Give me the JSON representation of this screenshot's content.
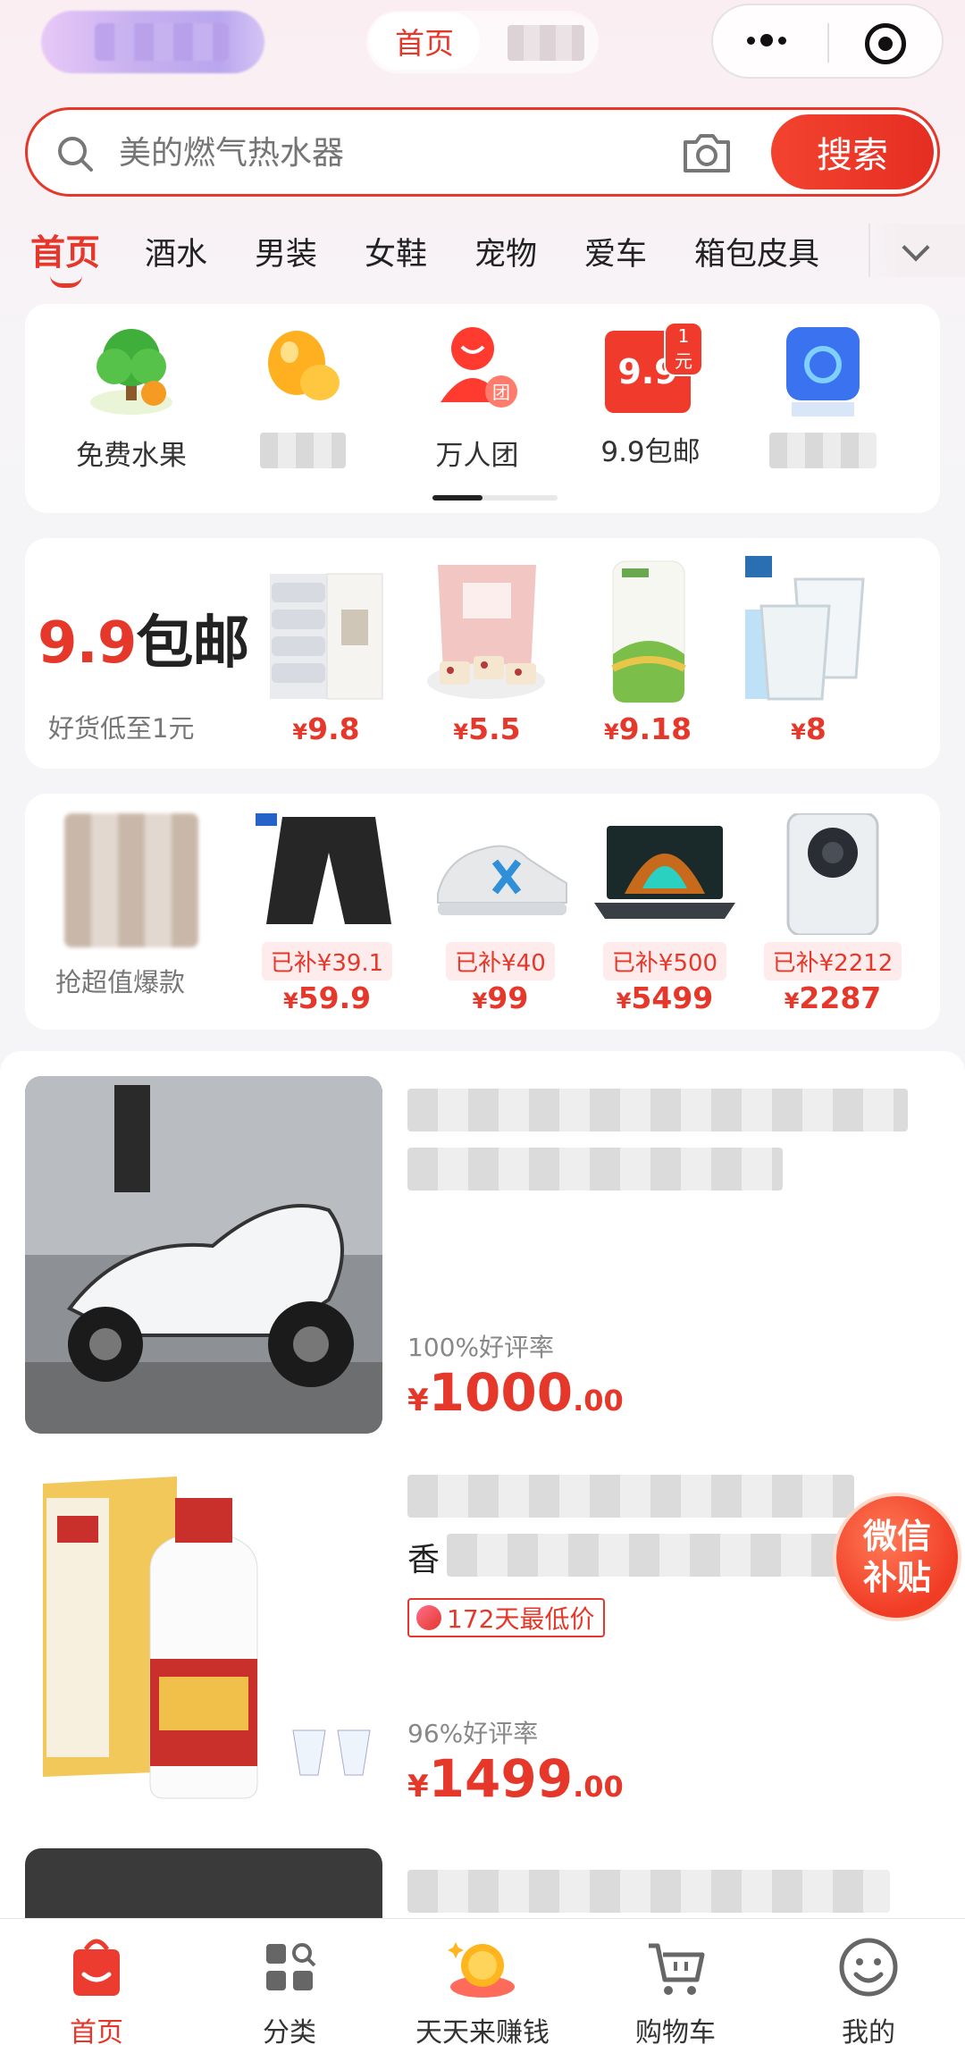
{
  "header": {
    "tab_home": "首页"
  },
  "search": {
    "placeholder": "美的燃气热水器",
    "button": "搜索"
  },
  "categories": [
    "首页",
    "酒水",
    "男装",
    "女鞋",
    "宠物",
    "爱车",
    "箱包皮具"
  ],
  "quick_entries": [
    {
      "label": "免费水果",
      "icon": "tree-fruit-icon"
    },
    {
      "label": "",
      "icon": "golden-beans-icon"
    },
    {
      "label": "万人团",
      "icon": "group-buy-icon"
    },
    {
      "label": "9.9包邮",
      "icon": "nine-nine-icon",
      "badge": "1元",
      "icon_text": "9.9"
    },
    {
      "label": "",
      "icon": "blue-box-icon"
    }
  ],
  "deal_99": {
    "title_red": "9.9",
    "title_black": "包邮",
    "subtitle": "好货低至1元",
    "products": [
      {
        "price": "9.8",
        "icon": "tissue-pack-icon"
      },
      {
        "price": "5.5",
        "icon": "snack-bag-icon"
      },
      {
        "price": "9.18",
        "icon": "rice-bag-icon"
      },
      {
        "price": "8",
        "icon": "glass-cups-icon"
      }
    ]
  },
  "deal_value": {
    "subtitle": "抢超值爆款",
    "products": [
      {
        "subsidy": "已补¥39.1",
        "price": "59.9",
        "icon": "pants-icon"
      },
      {
        "subsidy": "已补¥40",
        "price": "99",
        "icon": "sneaker-icon"
      },
      {
        "subsidy": "已补¥500",
        "price": "5499",
        "icon": "gaming-laptop-icon"
      },
      {
        "subsidy": "已补¥2212",
        "price": "2287",
        "icon": "smartphone-icon"
      }
    ]
  },
  "currency": "¥",
  "feed": [
    {
      "rating": "100%好评率",
      "price_int": "1000",
      "price_dec": ".00",
      "image": "white-scooter"
    },
    {
      "rating": "96%好评率",
      "price_int": "1499",
      "price_dec": ".00",
      "image": "moutai-liquor",
      "tag": "172天最低价",
      "title_visible": "香"
    }
  ],
  "wx_badge": {
    "line1": "微信",
    "line2": "补贴"
  },
  "bottom_nav": [
    {
      "label": "首页",
      "icon": "home-bag-icon"
    },
    {
      "label": "分类",
      "icon": "category-grid-icon"
    },
    {
      "label": "天天来赚钱",
      "icon": "gold-coin-icon"
    },
    {
      "label": "购物车",
      "icon": "cart-icon"
    },
    {
      "label": "我的",
      "icon": "smiley-profile-icon"
    }
  ],
  "colors": {
    "accent": "#e5372a"
  }
}
